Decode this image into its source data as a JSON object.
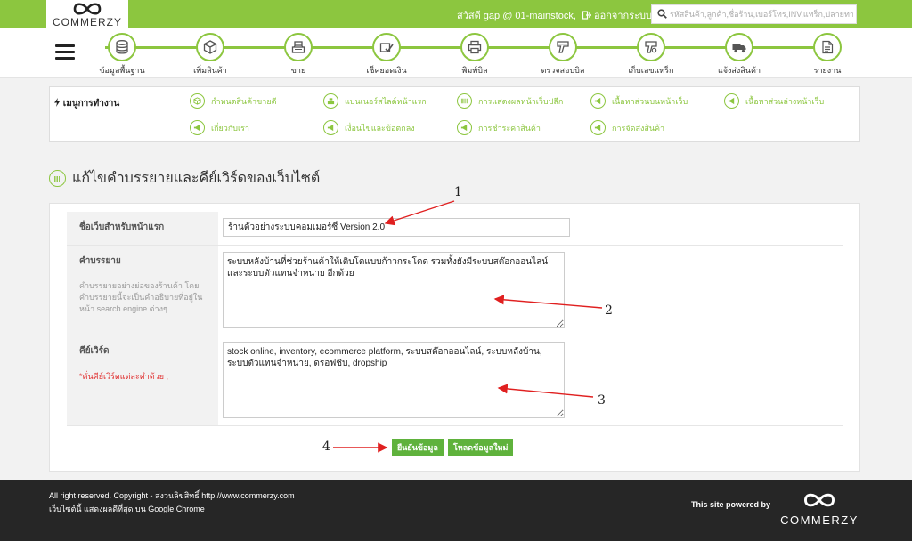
{
  "brand": {
    "name": "COMMERZY"
  },
  "header": {
    "greeting": "สวัสดี gap @ 01-mainstock,",
    "logout_label": "ออกจากระบบ",
    "search_placeholder": "รหัสสินค้า,ลูกค้า,ชื่อร้าน,เบอร์โทร,INV,แทร็ก,ปลายทาง"
  },
  "nav": {
    "items": [
      {
        "label": "ข้อมูลพื้นฐาน",
        "icon": "database-icon"
      },
      {
        "label": "เพิ่มสินค้า",
        "icon": "box-icon"
      },
      {
        "label": "ขาย",
        "icon": "cash-register-icon"
      },
      {
        "label": "เช็คยอดเงิน",
        "icon": "money-check-icon"
      },
      {
        "label": "พิมพ์บิล",
        "icon": "printer-icon"
      },
      {
        "label": "ตรวจสอบบิล",
        "icon": "barcode-scanner-icon"
      },
      {
        "label": "เก็บเลขแทร็ก",
        "icon": "tracking-icon"
      },
      {
        "label": "แจ้งส่งสินค้า",
        "icon": "truck-icon"
      },
      {
        "label": "รายงาน",
        "icon": "report-icon"
      }
    ]
  },
  "menu": {
    "title": "เมนูการทำงาน",
    "items": [
      {
        "label": "กำหนดสินค้าขายดี",
        "icon": "box-icon"
      },
      {
        "label": "แบนเนอร์สไลด์หน้าแรก",
        "icon": "cash-register-icon"
      },
      {
        "label": "การแสดงผลหน้าเว็บปลีก",
        "icon": "barcode-icon"
      },
      {
        "label": "เนื้อหาส่วนบนหน้าเว็บ",
        "icon": "megaphone-icon"
      },
      {
        "label": "เนื้อหาส่วนล่างหน้าเว็บ",
        "icon": "megaphone-icon"
      },
      {
        "label": "เกี่ยวกับเรา",
        "icon": "megaphone-icon"
      },
      {
        "label": "เงื่อนไขและข้อตกลง",
        "icon": "megaphone-icon"
      },
      {
        "label": "การชำระค่าสินค้า",
        "icon": "megaphone-icon"
      },
      {
        "label": "การจัดส่งสินค้า",
        "icon": "megaphone-icon"
      }
    ]
  },
  "page": {
    "title": "แก้ไขคำบรรยายและคีย์เวิร์ดของเว็บไซต์"
  },
  "form": {
    "site_name_label": "ชื่อเว็บสำหรับหน้าแรก",
    "site_name_value": "ร้านตัวอย่างระบบคอมเมอร์ซี่ Version 2.0",
    "description_label": "คำบรรยาย",
    "description_help": "คำบรรยายอย่างย่อของร้านค้า โดยคำบรรยายนี้จะเป็นคำอธิบายที่อยู่ในหน้า search engine ต่างๆ",
    "description_value": "ระบบหลังบ้านที่ช่วยร้านค้าให้เติบโตแบบก้าวกระโดด รวมทั้งยังมีระบบสต๊อกออนไลน์ และระบบตัวแทนจำหน่าย อีกด้วย",
    "keywords_label": "คีย์เวิร์ด",
    "keywords_help": "*คั่นคีย์เวิร์ดแต่ละคำด้วย ,",
    "keywords_value": "stock online, inventory, ecommerce platform, ระบบสต๊อกออนไลน์, ระบบหลังบ้าน, ระบบตัวแทนจำหน่าย, ดรอฟชิบ, dropship",
    "confirm_label": "ยืนยันข้อมูล",
    "reload_label": "โหลดข้อมูลใหม่"
  },
  "annotations": [
    "1",
    "2",
    "3",
    "4"
  ],
  "footer": {
    "copyright": "All right reserved. Copyright - สงวนลิขสิทธิ์ http://www.commerzy.com",
    "browser_note": "เว็บไซต์นี้ แสดงผลดีที่สุด บน Google Chrome",
    "powered_by": "This site powered by"
  },
  "colors": {
    "accent": "#8cc63f",
    "button": "#5fb23c",
    "footer": "#262626",
    "annotation": "#e02020"
  }
}
